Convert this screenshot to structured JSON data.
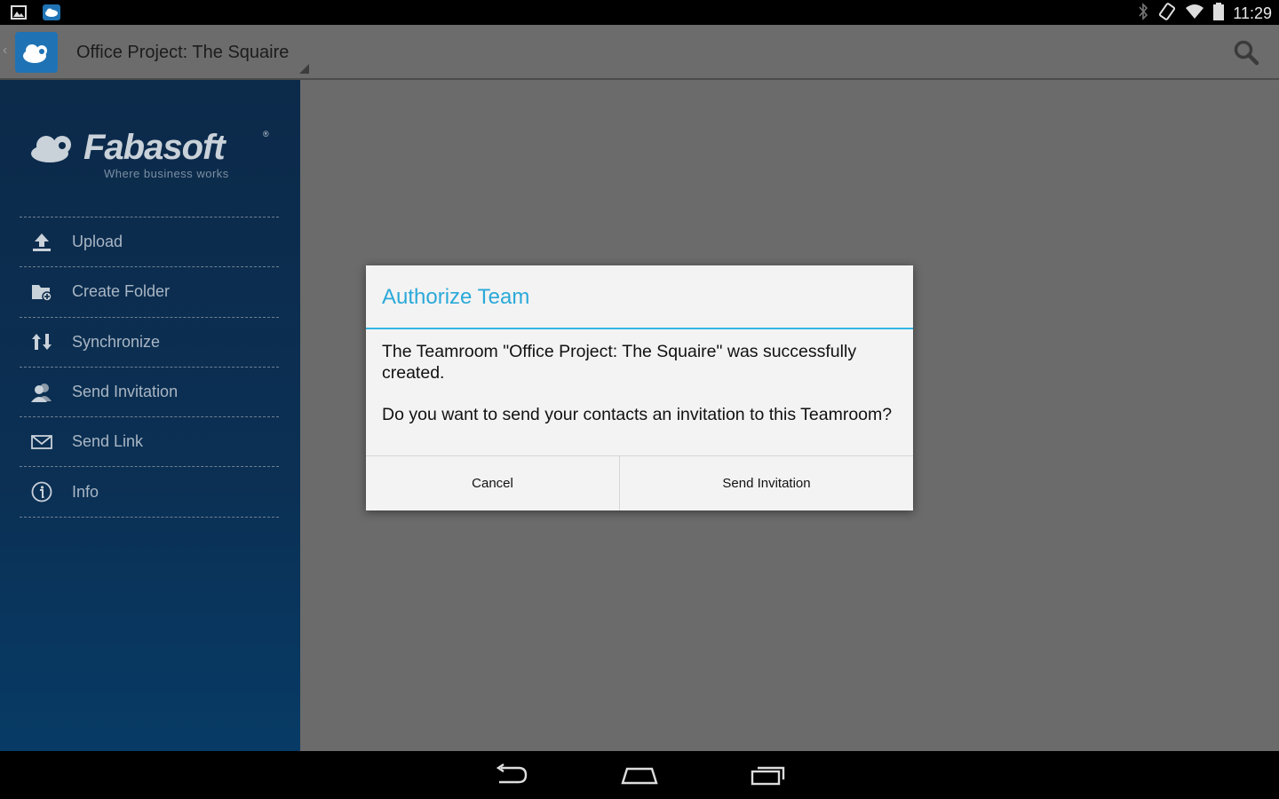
{
  "status_bar": {
    "time": "11:29",
    "left_icons": [
      "gallery-icon",
      "cloud-app-icon"
    ],
    "right_icons": [
      "bluetooth-icon",
      "rotation-lock-icon",
      "wifi-icon",
      "battery-icon"
    ]
  },
  "action_bar": {
    "title": "Office Project: The Squaire",
    "search_icon": "search-icon"
  },
  "sidebar": {
    "brand": {
      "name": "Fabasoft",
      "registered": "®",
      "tagline": "Where business works"
    },
    "items": [
      {
        "label": "Upload",
        "icon": "upload-icon"
      },
      {
        "label": "Create Folder",
        "icon": "create-folder-icon"
      },
      {
        "label": "Synchronize",
        "icon": "synchronize-icon"
      },
      {
        "label": "Send Invitation",
        "icon": "people-icon"
      },
      {
        "label": "Send Link",
        "icon": "envelope-icon"
      },
      {
        "label": "Info",
        "icon": "info-icon"
      }
    ]
  },
  "dialog": {
    "title": "Authorize Team",
    "message_1": "The Teamroom \"Office Project: The Squaire\" was successfully created.",
    "message_2": "Do you want to send your contacts an invitation to this Teamroom?",
    "cancel_label": "Cancel",
    "send_label": "Send Invitation"
  },
  "nav_bar": {
    "buttons": [
      "back-icon",
      "home-icon",
      "recents-icon"
    ]
  },
  "colors": {
    "accent": "#33b5e5",
    "sidebar_bg": "#0b3054",
    "logo_bg": "#1f73b5"
  }
}
